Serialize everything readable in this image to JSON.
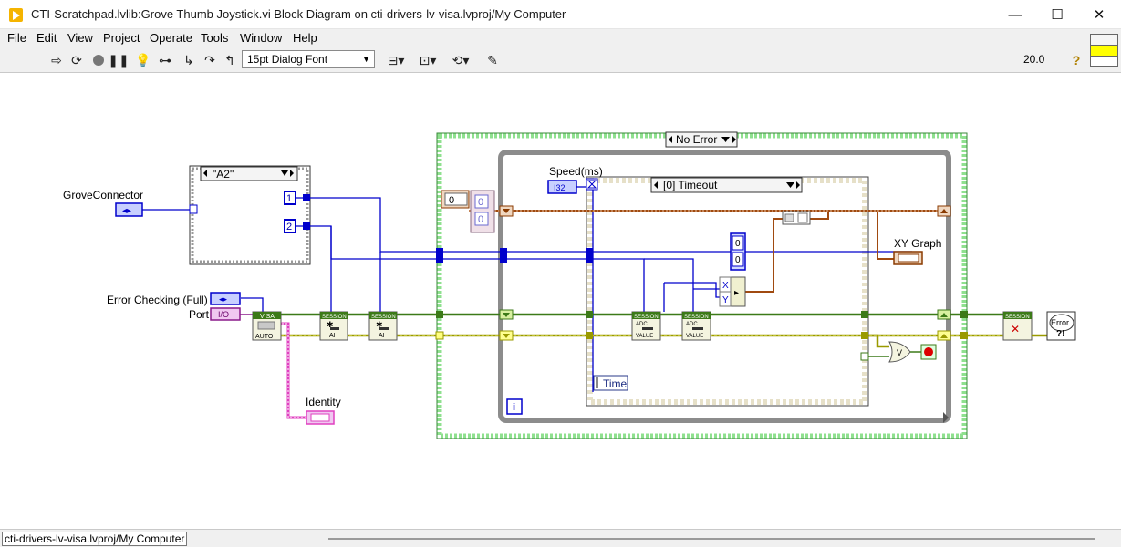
{
  "window": {
    "title": "CTI-Scratchpad.lvlib:Grove Thumb Joystick.vi Block Diagram on cti-drivers-lv-visa.lvproj/My Computer",
    "minimize_glyph": "—",
    "maximize_glyph": "☐",
    "close_glyph": "✕"
  },
  "menu": [
    "File",
    "Edit",
    "View",
    "Project",
    "Operate",
    "Tools",
    "Window",
    "Help"
  ],
  "toolbar": {
    "font": "15pt Dialog Font",
    "zoom": "20.0",
    "help_glyph": "?",
    "icons": [
      "run-icon",
      "run-continuously-icon",
      "abort-icon",
      "pause-icon",
      "highlight-execution-icon",
      "retain-wire-values-icon",
      "step-into-icon",
      "step-over-icon",
      "step-out-icon",
      "align-objects-icon",
      "distribute-objects-icon",
      "reorder-icon",
      "clean-up-diagram-icon"
    ]
  },
  "diagram": {
    "case_selector": "\"A2\"",
    "case_out_1": "1",
    "case_out_2": "2",
    "grove_connector_label": "GroveConnector",
    "error_checking_label": "Error Checking (Full)",
    "port_label": "Port",
    "port_terminal": "I/O",
    "identity_label": "Identity",
    "visa_open": "VISA",
    "visa_auto": "AUTO",
    "session": "SESSION",
    "ai": "AI",
    "adc": "ADC",
    "value": "VALUE",
    "outer_case_selector": "No Error",
    "shift_reg_init": "0",
    "cluster_val_1": "0",
    "cluster_val_2": "0",
    "speed_label": "Speed(ms)",
    "speed_type": "I32",
    "event_selector": "[0] Timeout",
    "event_time": "Time",
    "xy_out_x": "0",
    "xy_out_y": "0",
    "bundle_x": "X",
    "bundle_y": "Y",
    "xy_graph_label": "XY Graph",
    "iteration": "i",
    "or_label": "V",
    "error_label": "Error"
  },
  "colors": {
    "error_wire": "#9a9a00",
    "visa_wire": "#3c7a18",
    "int_wire": "#0000cc",
    "cluster_wire": "#a04a10",
    "string_wire": "#e040c0",
    "case_border": "#6bd06b",
    "loop_border": "#8a8a8a"
  },
  "status": {
    "context": "cti-drivers-lv-visa.lvproj/My Computer"
  }
}
